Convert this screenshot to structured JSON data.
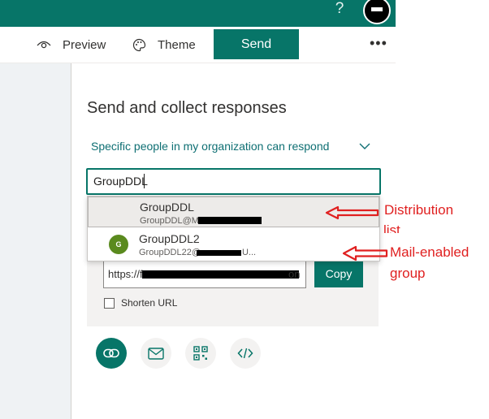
{
  "header": {
    "help_label": "?"
  },
  "toolbar": {
    "preview_label": "Preview",
    "theme_label": "Theme",
    "send_label": "Send",
    "more_label": "•••"
  },
  "panel": {
    "title": "Send and collect responses",
    "audience": "Specific people in my organization can respond",
    "input_value": "GroupDDL",
    "suggestions": [
      {
        "name": "GroupDDL",
        "email": "GroupDDL@M"
      },
      {
        "name": "GroupDDL2",
        "email": "GroupDDL22@",
        "email_tail": "U...",
        "avatar_letter": "G",
        "avatar_color": "#5a8a1e"
      }
    ],
    "url_start": "https://f",
    "url_end": "on",
    "copy_label": "Copy",
    "shorten_label": "Shorten URL"
  },
  "annotations": {
    "distribution": "Distribution",
    "distribution_cut": "list",
    "mail_enabled": "Mail-enabled",
    "group": "group"
  },
  "colors": {
    "accent": "#077568",
    "annotation": "#e02020",
    "link_text": "#0e6f73"
  },
  "icons": [
    "eye-icon",
    "palette-icon",
    "people-icon",
    "chevron-down-icon",
    "link-icon",
    "mail-icon",
    "qr-code-icon",
    "embed-icon",
    "arrow-left-icon"
  ]
}
